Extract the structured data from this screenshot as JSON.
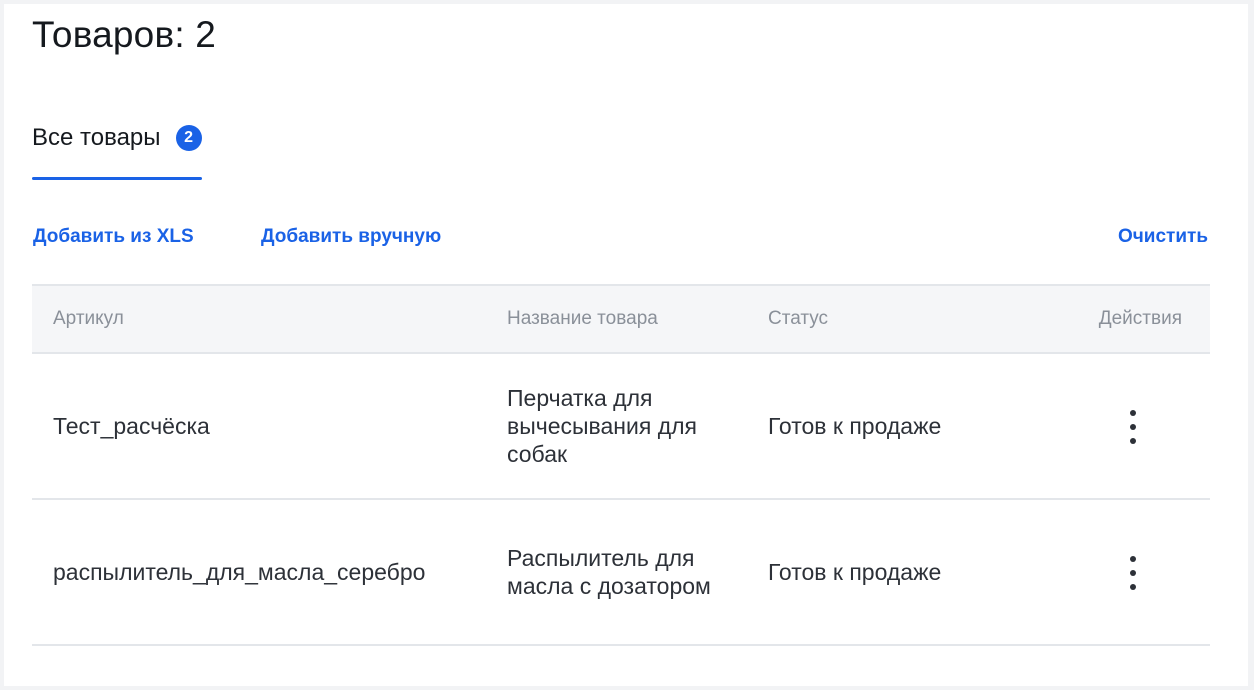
{
  "header": {
    "title": "Товаров: 2"
  },
  "tabs": [
    {
      "label": "Все товары",
      "badge": "2",
      "active": true
    }
  ],
  "toolbar": {
    "add_xls_label": "Добавить из XLS",
    "add_manual_label": "Добавить вручную",
    "clear_label": "Очистить"
  },
  "table": {
    "columns": [
      "Артикул",
      "Название товара",
      "Статус",
      "Действия"
    ],
    "rows": [
      {
        "article": "Тест_расчёска",
        "name": "Перчатка для вычесывания для собак",
        "status": "Готов к продаже",
        "actions_icon": "more-vertical-icon"
      },
      {
        "article": "распылитель_для_масла_серебро",
        "name": "Распылитель для масла с дозатором",
        "status": "Готов к продаже",
        "actions_icon": "more-vertical-icon"
      }
    ]
  },
  "colors": {
    "accent": "#1a62e6",
    "text": "#15191e",
    "muted": "#8a9099",
    "divider": "#e3e6ea"
  }
}
